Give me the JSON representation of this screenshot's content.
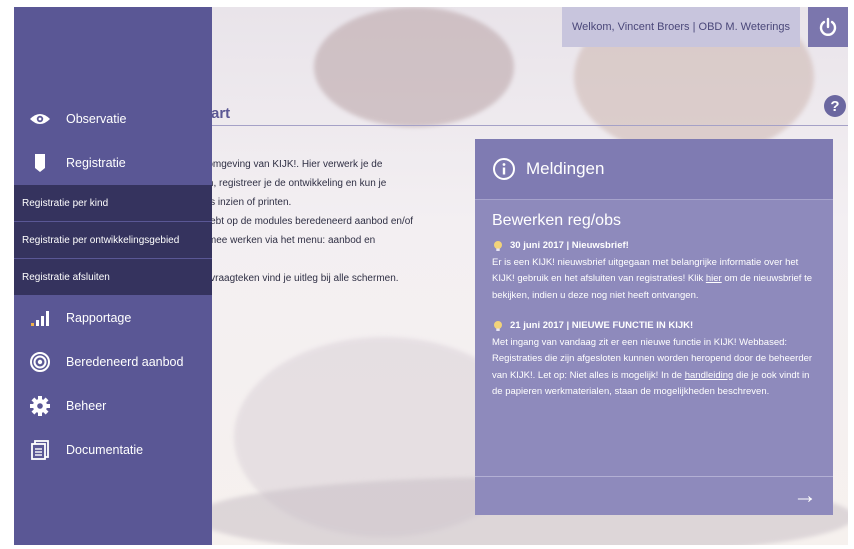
{
  "header": {
    "user_text": "Welkom, Vincent Broers | OBD M. Weterings",
    "logout_icon": "power-icon"
  },
  "page": {
    "title": "art",
    "help_label": "?",
    "intro": [
      "e omgeving van KIJK!. Hier verwerk je de",
      "ren, registreer je de ontwikkeling en kun je",
      "ges inzien of printen.",
      "t hebt op de modules beredeneerd aanbod en/of",
      "armee werken via het menu: aanbod en",
      "",
      "et vraagteken vind je uitleg bij alle schermen."
    ]
  },
  "sidebar": {
    "items": [
      {
        "label": "Observatie",
        "icon": "eye-icon"
      },
      {
        "label": "Registratie",
        "icon": "tag-icon"
      },
      {
        "label": "Rapportage",
        "icon": "bar-chart-icon"
      },
      {
        "label": "Beredeneerd aanbod",
        "icon": "target-icon"
      },
      {
        "label": "Beheer",
        "icon": "gear-icon"
      },
      {
        "label": "Documentatie",
        "icon": "document-icon"
      }
    ],
    "submenu": [
      {
        "label": "Registratie per kind"
      },
      {
        "label": "Registratie per ontwikkelingsgebied"
      },
      {
        "label": "Registratie afsluiten"
      }
    ]
  },
  "notifications": {
    "title": "Meldingen",
    "subtitle": "Bewerken reg/obs",
    "messages": [
      {
        "heading": "30 juni 2017 | Nieuwsbrief!",
        "text_before": "Er is een KIJK! nieuwsbrief uitgegaan met belangrijke informatie over het KIJK! gebruik en het afsluiten van registraties! Klik ",
        "link": "hier",
        "text_after": " om de nieuwsbrief te bekijken, indien u deze nog niet heeft ontvangen."
      },
      {
        "heading": "21 juni 2017 | NIEUWE FUNCTIE IN KIJK!",
        "text_before": "Met ingang van vandaag zit er een nieuwe functie in KIJK! Webbased: Registraties die zijn afgesloten kunnen worden heropend door de beheerder van KIJK!. Let op: Niet alles is mogelijk! In de ",
        "link": "handleiding",
        "text_after": " die je ook vindt in de papieren werkmaterialen, staan de mogelijkheden beschreven."
      }
    ],
    "more_arrow": "→"
  },
  "colors": {
    "sidebar": "#5a5795",
    "submenu": "#35335e",
    "panel": "#8e8abc",
    "accent": "#7b76ad"
  }
}
